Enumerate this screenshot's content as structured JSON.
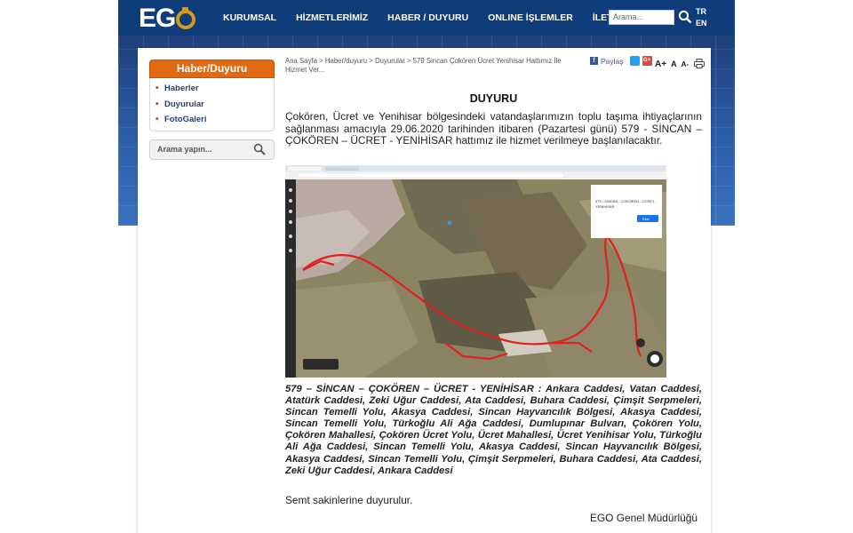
{
  "header": {
    "logo_text": "EGO",
    "nav": [
      "KURUMSAL",
      "HİZMETLERİMİZ",
      "HABER / DUYURU",
      "ONLINE İŞLEMLER",
      "İLETİŞİM"
    ],
    "search_placeholder": "Arama...",
    "lang_tr": "TR",
    "lang_en": "EN"
  },
  "sidebar": {
    "title": "Haber/Duyuru",
    "items": [
      "Haberler",
      "Duyurular",
      "FotoGaleri"
    ],
    "search_placeholder": "Arama yapın..."
  },
  "toolbar": {
    "breadcrumb": "Ana Sayfa > Haber/duyuru > Duyurular > 579 Sincan Çokören Ücret Yenihisar Hattımız İle Hizmet Ver...",
    "share_label": "Paylaş",
    "gplus_label": "G+",
    "font_sizes": [
      "A+",
      "A",
      "A-"
    ]
  },
  "article": {
    "title": "DUYURU",
    "intro": "Çokören, Ücret ve Yenihisar bölgesindeki vatandaşlarımızın toplu taşıma ihtiyaçlarının sağlanması amacıyla 29.06.2020 tarihinden itibaren (Pazartesi günü) 579 - SİNCAN – ÇOKÖREN – ÜCRET - YENİHİSAR hattımız ile hizmet verilmeye başlanılacaktır.",
    "route_text": "579 – SİNCAN – ÇOKÖREN – ÜCRET - YENİHİSAR : Ankara Caddesi, Vatan Caddesi, Atatürk Caddesi, Zeki Uğur Caddesi, Ata Caddesi, Buhara Caddesi, Çimşit Serpmeleri, Sincan Temelli Yolu, Akasya Caddesi, Sincan Hayvancılık Bölgesi, Akasya Caddesi, Sincan Temelli Yolu, Türkoğlu Ali Ağa Caddesi, Dumlupınar Bulvarı, Çokören Yolu, Çokören Mahallesi, Çokören Ücret Yolu, Ücret Mahallesi, Ücret Yenihisar Yolu, Türkoğlu Ali Ağa Caddesi, Sincan Temelli Yolu, Akasya Caddesi, Sincan Hayvancılık Bölgesi, Akasya Caddesi, Sincan Temelli Yolu, Çimşit Serpmeleri, Buhara Caddesi, Ata Caddesi, Zeki Uğur Caddesi, Ankara Caddesi",
    "note": "Semt sakinlerine duyurulur.",
    "signature": "EGO Genel Müdürlüğü"
  },
  "map": {
    "popup_lines": [
      "579 - SİNCAN - ÇOKÖREN - ÜCRET -",
      "YENİHİSAR"
    ],
    "popup_button": "Ekle"
  }
}
